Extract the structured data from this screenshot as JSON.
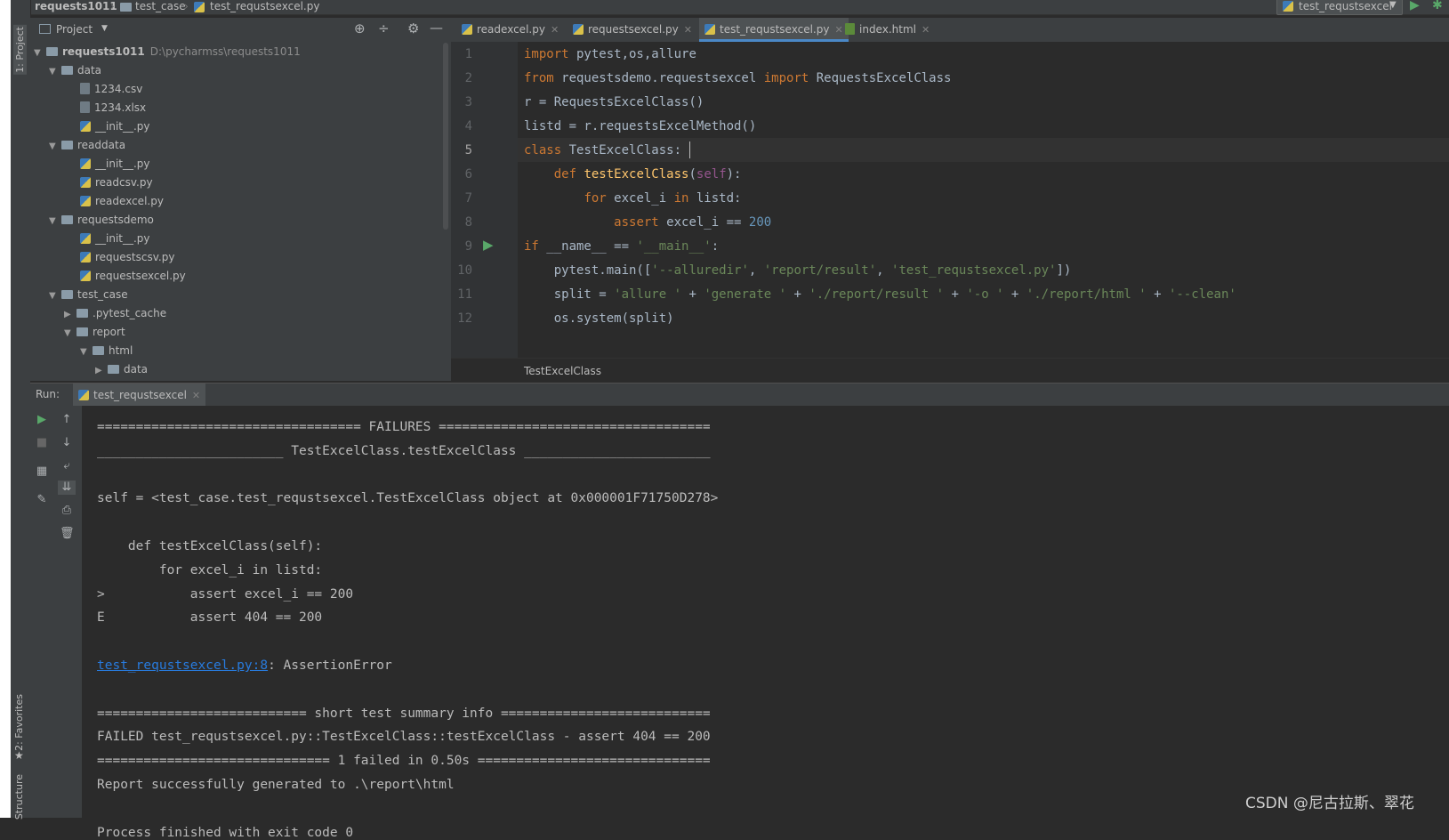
{
  "navbar": {
    "crumbs": [
      "requests1011",
      "test_case",
      "test_requstsexcel.py"
    ],
    "run_config": "test_requstsexcel"
  },
  "side_tabs": {
    "project": "1: Project",
    "favorites": "2: Favorites",
    "structure": "Structure"
  },
  "project": {
    "title": "Project",
    "tree": [
      {
        "label": "requests1011",
        "note": "D:\\pycharmss\\requests1011"
      },
      {
        "label": "data"
      },
      {
        "label": "1234.csv"
      },
      {
        "label": "1234.xlsx"
      },
      {
        "label": "__init__.py"
      },
      {
        "label": "readdata"
      },
      {
        "label": "__init__.py"
      },
      {
        "label": "readcsv.py"
      },
      {
        "label": "readexcel.py"
      },
      {
        "label": "requestsdemo"
      },
      {
        "label": "__init__.py"
      },
      {
        "label": "requestscsv.py"
      },
      {
        "label": "requestsexcel.py"
      },
      {
        "label": "test_case"
      },
      {
        "label": ".pytest_cache"
      },
      {
        "label": "report"
      },
      {
        "label": "html"
      },
      {
        "label": "data"
      }
    ]
  },
  "editor": {
    "tabs": [
      "readexcel.py",
      "requestsexcel.py",
      "test_requstsexcel.py",
      "index.html"
    ],
    "active_tab": "test_requstsexcel.py",
    "line_numbers": [
      "1",
      "2",
      "3",
      "4",
      "5",
      "6",
      "7",
      "8",
      "9",
      "10",
      "11",
      "12"
    ],
    "code": [
      [
        [
          "kw",
          "import"
        ],
        [
          "t",
          " pytest,os,allure"
        ]
      ],
      [
        [
          "kw",
          "from"
        ],
        [
          "t",
          " requestsdemo.requestsexcel "
        ],
        [
          "kw",
          "import"
        ],
        [
          "t",
          " RequestsExcelClass"
        ]
      ],
      [
        [
          "t",
          "r = RequestsExcelClass()"
        ]
      ],
      [
        [
          "t",
          "listd = r.requestsExcelMethod()"
        ]
      ],
      [
        [
          "kw",
          "class"
        ],
        [
          "t",
          " TestExcelClass:"
        ]
      ],
      [
        [
          "t",
          "    "
        ],
        [
          "kw",
          "def"
        ],
        [
          "t",
          " "
        ],
        [
          "fn",
          "testExcelClass"
        ],
        [
          "t",
          "("
        ],
        [
          "self",
          "self"
        ],
        [
          "t",
          "):"
        ]
      ],
      [
        [
          "t",
          "        "
        ],
        [
          "kw",
          "for"
        ],
        [
          "t",
          " excel_i "
        ],
        [
          "kw",
          "in"
        ],
        [
          "t",
          " listd:"
        ]
      ],
      [
        [
          "t",
          "            "
        ],
        [
          "kw",
          "assert"
        ],
        [
          "t",
          " excel_i == "
        ],
        [
          "num",
          "200"
        ]
      ],
      [
        [
          "kw",
          "if"
        ],
        [
          "t",
          " __name__ == "
        ],
        [
          "str",
          "'__main__'"
        ],
        [
          "t",
          ":"
        ]
      ],
      [
        [
          "t",
          "    pytest.main(["
        ],
        [
          "str",
          "'--alluredir'"
        ],
        [
          "t",
          ", "
        ],
        [
          "str",
          "'report/result'"
        ],
        [
          "t",
          ", "
        ],
        [
          "str",
          "'test_requstsexcel.py'"
        ],
        [
          "t",
          "])"
        ]
      ],
      [
        [
          "t",
          "    split = "
        ],
        [
          "str",
          "'allure '"
        ],
        [
          "t",
          " + "
        ],
        [
          "str",
          "'generate '"
        ],
        [
          "t",
          " + "
        ],
        [
          "str",
          "'./report/result '"
        ],
        [
          "t",
          " + "
        ],
        [
          "str",
          "'-o '"
        ],
        [
          "t",
          " + "
        ],
        [
          "str",
          "'./report/html '"
        ],
        [
          "t",
          " + "
        ],
        [
          "str",
          "'--clean'"
        ]
      ],
      [
        [
          "t",
          "    os.system(split)"
        ]
      ]
    ],
    "breadcrumb": "TestExcelClass"
  },
  "run": {
    "label": "Run:",
    "tab": "test_requstsexcel",
    "console": [
      "================================== FAILURES ===================================",
      "________________________ TestExcelClass.testExcelClass ________________________",
      "",
      "self = <test_case.test_requstsexcel.TestExcelClass object at 0x000001F71750D278>",
      "",
      "    def testExcelClass(self):",
      "        for excel_i in listd:",
      ">           assert excel_i == 200",
      "E           assert 404 == 200",
      "",
      "",
      "",
      "=========================== short test summary info ===========================",
      "FAILED test_requstsexcel.py::TestExcelClass::testExcelClass - assert 404 == 200",
      "============================== 1 failed in 0.50s ==============================",
      "Report successfully generated to .\\report\\html",
      "",
      "Process finished with exit code 0"
    ],
    "error_link": "test_requstsexcel.py:8",
    "error_text": ": AssertionError"
  },
  "watermark": "CSDN @尼古拉斯、翠花",
  "colors": {
    "accent": "#4a88c7",
    "keyword": "#cc7832",
    "string": "#6a8759",
    "number": "#6897bb",
    "link": "#287bde"
  }
}
